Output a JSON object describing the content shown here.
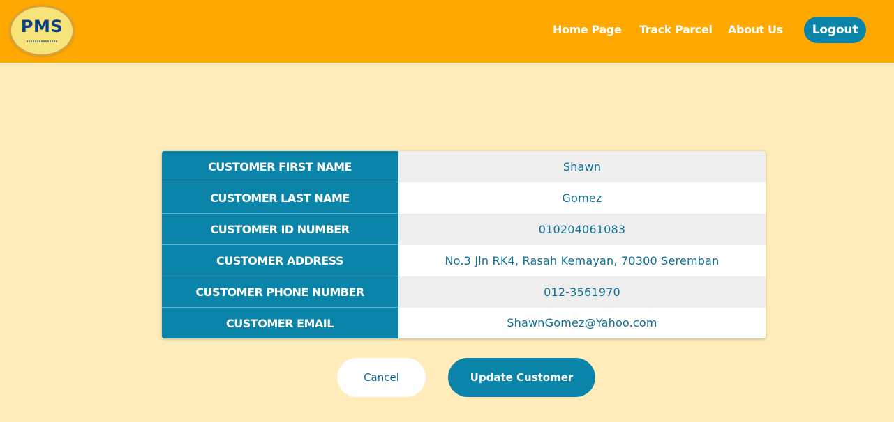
{
  "header": {
    "logo_text": "PMS",
    "nav": [
      {
        "label": "Home Page"
      },
      {
        "label": "Track Parcel"
      },
      {
        "label": "About Us"
      }
    ],
    "logout_label": "Logout"
  },
  "customer": {
    "rows": [
      {
        "label": "CUSTOMER FIRST NAME",
        "value": "Shawn"
      },
      {
        "label": "CUSTOMER LAST NAME",
        "value": "Gomez"
      },
      {
        "label": "CUSTOMER ID NUMBER",
        "value": "010204061083"
      },
      {
        "label": "CUSTOMER ADDRESS",
        "value": "No.3 Jln RK4, Rasah Kemayan, 70300 Seremban"
      },
      {
        "label": "CUSTOMER PHONE NUMBER",
        "value": "012-3561970"
      },
      {
        "label": "CUSTOMER EMAIL",
        "value": "ShawnGomez@Yahoo.com"
      }
    ]
  },
  "actions": {
    "cancel_label": "Cancel",
    "update_label": "Update Customer"
  },
  "colors": {
    "header_bg": "#ffa800",
    "page_bg": "#ffecba",
    "accent": "#0a84a8"
  }
}
